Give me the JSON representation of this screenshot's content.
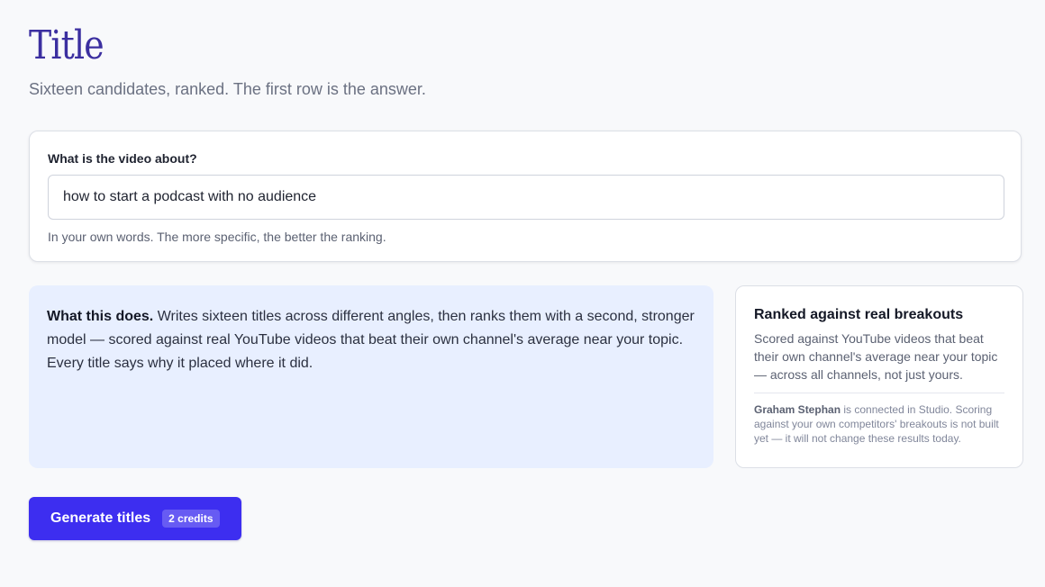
{
  "header": {
    "title": "Title",
    "subtitle": "Sixteen candidates, ranked. The first row is the answer."
  },
  "input_card": {
    "label": "What is the video about?",
    "value": "how to start a podcast with no audience",
    "help": "In your own words. The more specific, the better the ranking."
  },
  "info_panel": {
    "lead": "What this does.",
    "body": "Writes sixteen titles across different angles, then ranks them with a second, stronger model — scored against real YouTube videos that beat their own channel's average near your topic. Every title says why it placed where it did."
  },
  "side_card": {
    "title": "Ranked against real breakouts",
    "body": "Scored against YouTube videos that beat their own channel's average near your topic — across all channels, not just yours.",
    "channel_name": "Graham Stephan",
    "note": "is connected in Studio. Scoring against your own competitors' breakouts is not built yet — it will not change these results today."
  },
  "action": {
    "button_label": "Generate titles",
    "credits_label": "2 credits"
  },
  "colors": {
    "accent": "#3d2ef0",
    "title": "#3b2fa0",
    "info_panel_bg": "#e8efff",
    "page_bg": "#f8f9fb"
  }
}
